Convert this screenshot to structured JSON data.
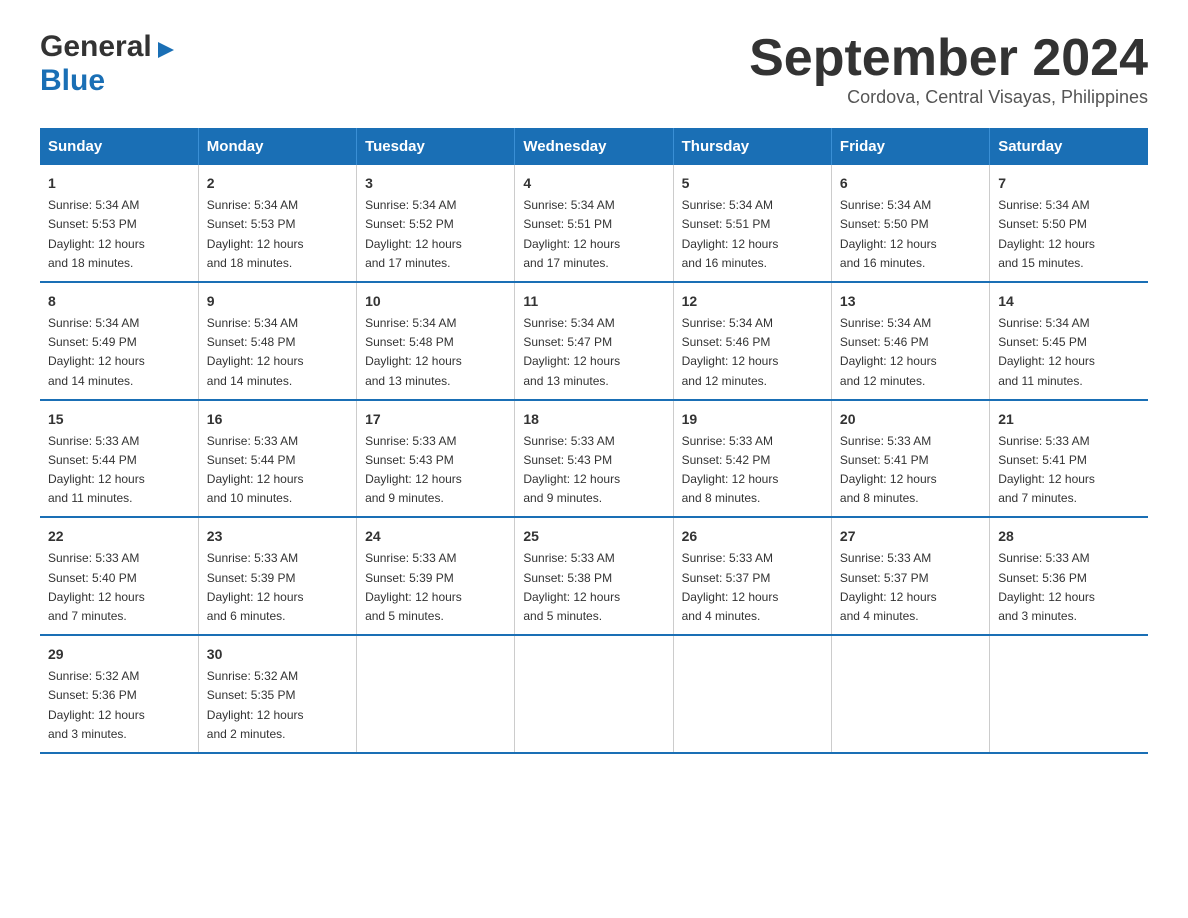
{
  "header": {
    "logo_general": "General",
    "logo_blue": "Blue",
    "month_title": "September 2024",
    "subtitle": "Cordova, Central Visayas, Philippines"
  },
  "days_of_week": [
    "Sunday",
    "Monday",
    "Tuesday",
    "Wednesday",
    "Thursday",
    "Friday",
    "Saturday"
  ],
  "weeks": [
    [
      {
        "day": "1",
        "sunrise": "5:34 AM",
        "sunset": "5:53 PM",
        "daylight": "12 hours and 18 minutes."
      },
      {
        "day": "2",
        "sunrise": "5:34 AM",
        "sunset": "5:53 PM",
        "daylight": "12 hours and 18 minutes."
      },
      {
        "day": "3",
        "sunrise": "5:34 AM",
        "sunset": "5:52 PM",
        "daylight": "12 hours and 17 minutes."
      },
      {
        "day": "4",
        "sunrise": "5:34 AM",
        "sunset": "5:51 PM",
        "daylight": "12 hours and 17 minutes."
      },
      {
        "day": "5",
        "sunrise": "5:34 AM",
        "sunset": "5:51 PM",
        "daylight": "12 hours and 16 minutes."
      },
      {
        "day": "6",
        "sunrise": "5:34 AM",
        "sunset": "5:50 PM",
        "daylight": "12 hours and 16 minutes."
      },
      {
        "day": "7",
        "sunrise": "5:34 AM",
        "sunset": "5:50 PM",
        "daylight": "12 hours and 15 minutes."
      }
    ],
    [
      {
        "day": "8",
        "sunrise": "5:34 AM",
        "sunset": "5:49 PM",
        "daylight": "12 hours and 14 minutes."
      },
      {
        "day": "9",
        "sunrise": "5:34 AM",
        "sunset": "5:48 PM",
        "daylight": "12 hours and 14 minutes."
      },
      {
        "day": "10",
        "sunrise": "5:34 AM",
        "sunset": "5:48 PM",
        "daylight": "12 hours and 13 minutes."
      },
      {
        "day": "11",
        "sunrise": "5:34 AM",
        "sunset": "5:47 PM",
        "daylight": "12 hours and 13 minutes."
      },
      {
        "day": "12",
        "sunrise": "5:34 AM",
        "sunset": "5:46 PM",
        "daylight": "12 hours and 12 minutes."
      },
      {
        "day": "13",
        "sunrise": "5:34 AM",
        "sunset": "5:46 PM",
        "daylight": "12 hours and 12 minutes."
      },
      {
        "day": "14",
        "sunrise": "5:34 AM",
        "sunset": "5:45 PM",
        "daylight": "12 hours and 11 minutes."
      }
    ],
    [
      {
        "day": "15",
        "sunrise": "5:33 AM",
        "sunset": "5:44 PM",
        "daylight": "12 hours and 11 minutes."
      },
      {
        "day": "16",
        "sunrise": "5:33 AM",
        "sunset": "5:44 PM",
        "daylight": "12 hours and 10 minutes."
      },
      {
        "day": "17",
        "sunrise": "5:33 AM",
        "sunset": "5:43 PM",
        "daylight": "12 hours and 9 minutes."
      },
      {
        "day": "18",
        "sunrise": "5:33 AM",
        "sunset": "5:43 PM",
        "daylight": "12 hours and 9 minutes."
      },
      {
        "day": "19",
        "sunrise": "5:33 AM",
        "sunset": "5:42 PM",
        "daylight": "12 hours and 8 minutes."
      },
      {
        "day": "20",
        "sunrise": "5:33 AM",
        "sunset": "5:41 PM",
        "daylight": "12 hours and 8 minutes."
      },
      {
        "day": "21",
        "sunrise": "5:33 AM",
        "sunset": "5:41 PM",
        "daylight": "12 hours and 7 minutes."
      }
    ],
    [
      {
        "day": "22",
        "sunrise": "5:33 AM",
        "sunset": "5:40 PM",
        "daylight": "12 hours and 7 minutes."
      },
      {
        "day": "23",
        "sunrise": "5:33 AM",
        "sunset": "5:39 PM",
        "daylight": "12 hours and 6 minutes."
      },
      {
        "day": "24",
        "sunrise": "5:33 AM",
        "sunset": "5:39 PM",
        "daylight": "12 hours and 5 minutes."
      },
      {
        "day": "25",
        "sunrise": "5:33 AM",
        "sunset": "5:38 PM",
        "daylight": "12 hours and 5 minutes."
      },
      {
        "day": "26",
        "sunrise": "5:33 AM",
        "sunset": "5:37 PM",
        "daylight": "12 hours and 4 minutes."
      },
      {
        "day": "27",
        "sunrise": "5:33 AM",
        "sunset": "5:37 PM",
        "daylight": "12 hours and 4 minutes."
      },
      {
        "day": "28",
        "sunrise": "5:33 AM",
        "sunset": "5:36 PM",
        "daylight": "12 hours and 3 minutes."
      }
    ],
    [
      {
        "day": "29",
        "sunrise": "5:32 AM",
        "sunset": "5:36 PM",
        "daylight": "12 hours and 3 minutes."
      },
      {
        "day": "30",
        "sunrise": "5:32 AM",
        "sunset": "5:35 PM",
        "daylight": "12 hours and 2 minutes."
      },
      null,
      null,
      null,
      null,
      null
    ]
  ],
  "labels": {
    "sunrise_prefix": "Sunrise: ",
    "sunset_prefix": "Sunset: ",
    "daylight_prefix": "Daylight: "
  }
}
